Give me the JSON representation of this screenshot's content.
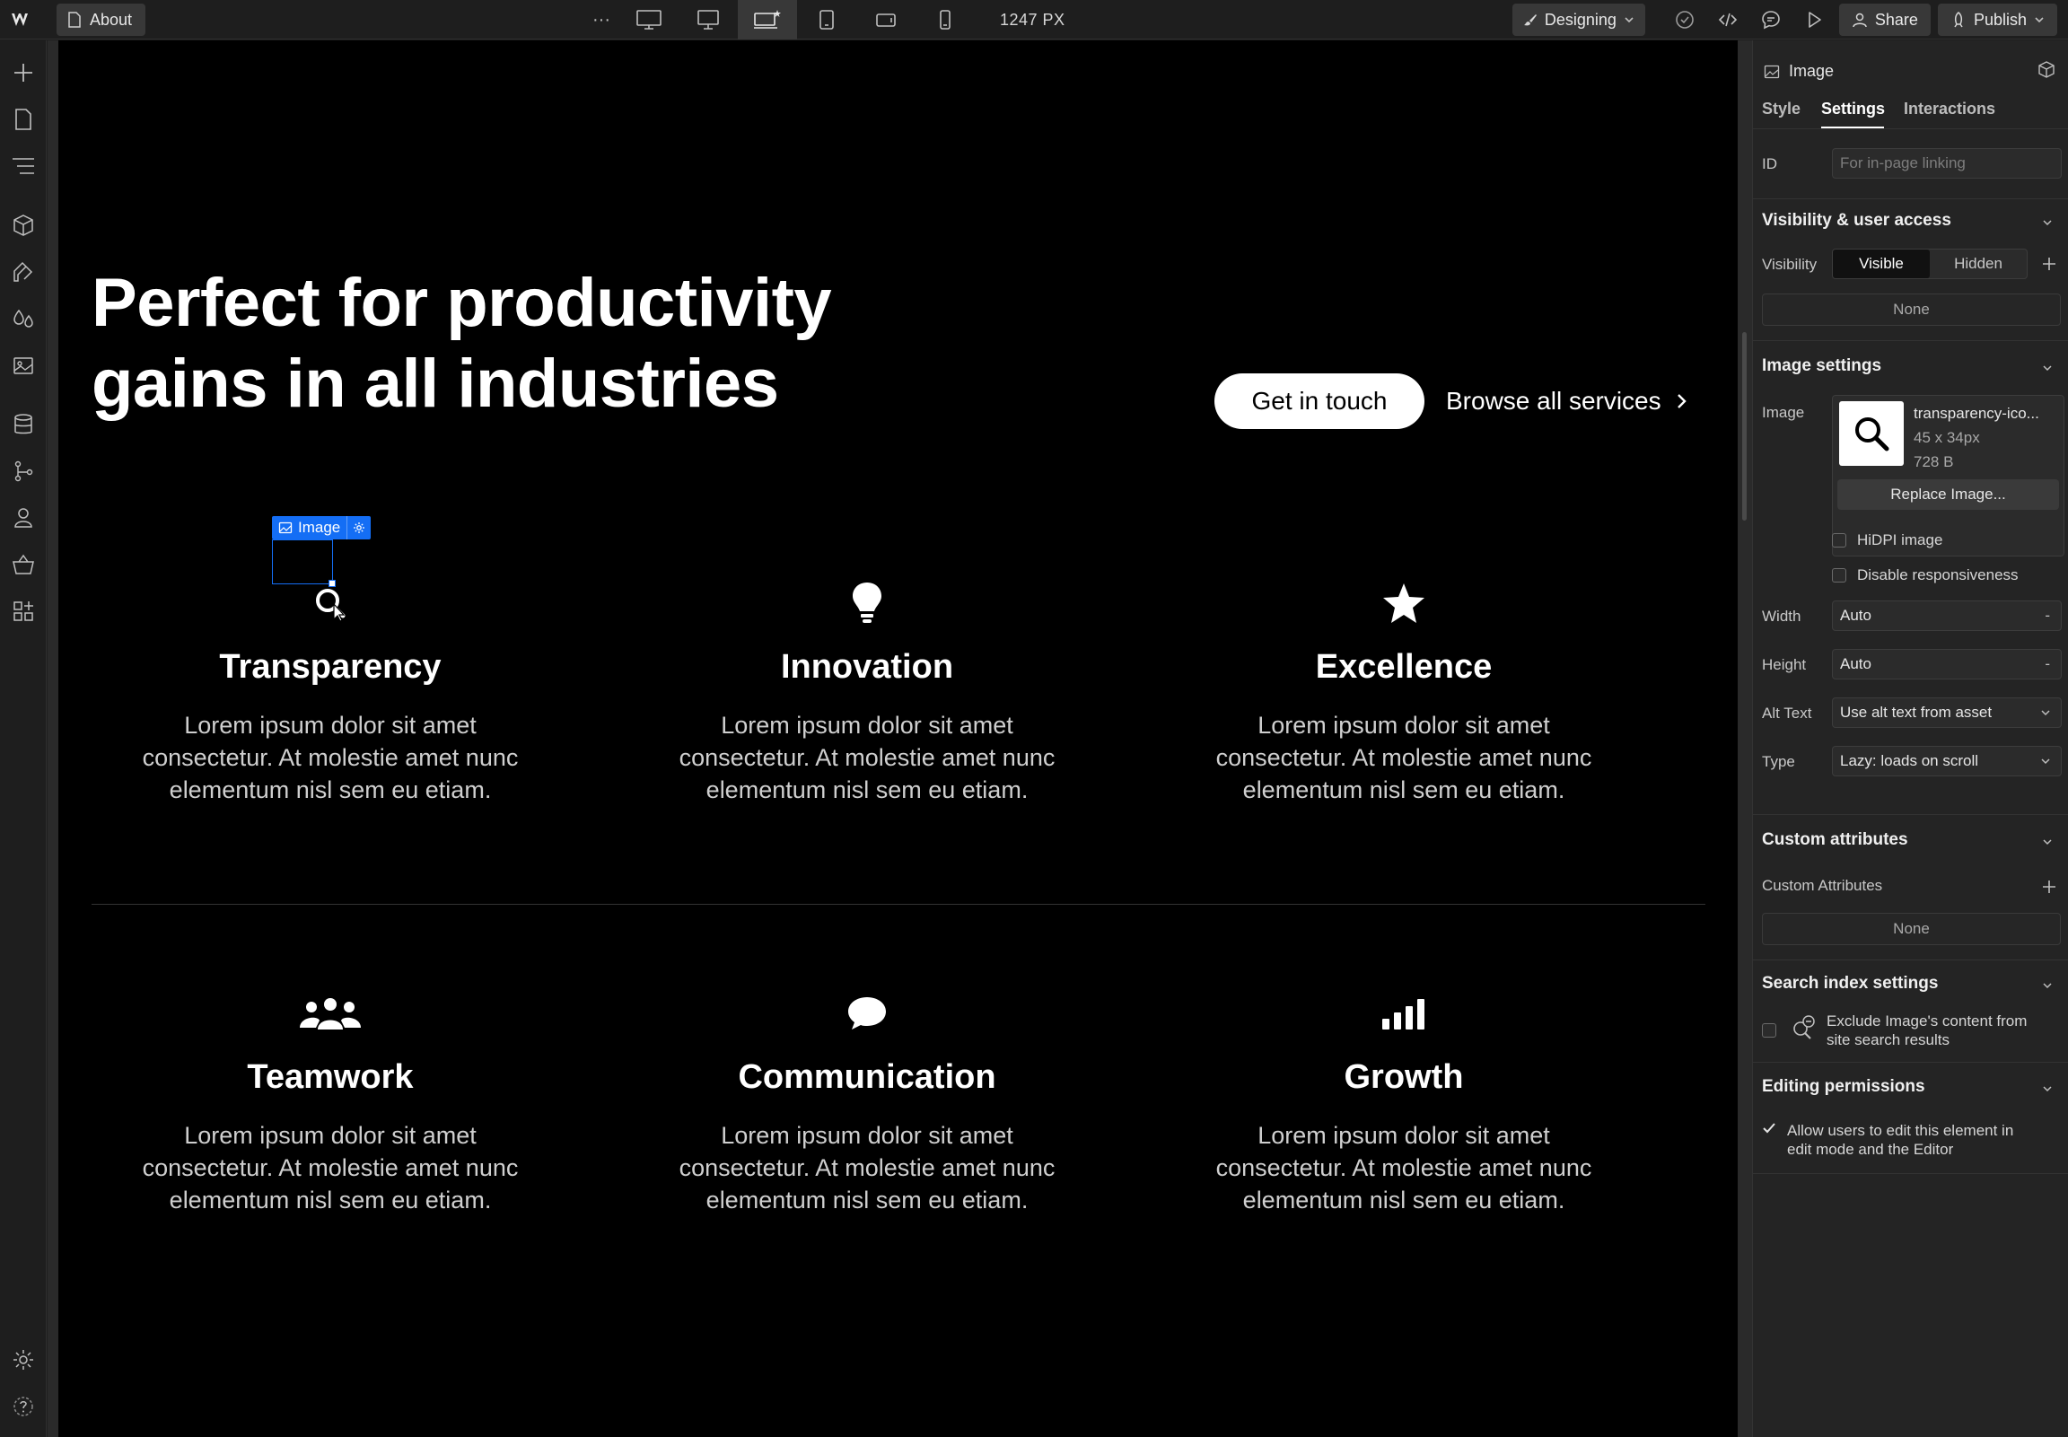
{
  "topbar": {
    "page_name": "About",
    "more_glyph": "···",
    "breakpoint_width": "1247 PX",
    "mode_label": "Designing",
    "share_label": "Share",
    "publish_label": "Publish"
  },
  "hero": {
    "title_line1": "Perfect for productivity",
    "title_line2": "gains in all industries",
    "primary_cta": "Get in touch",
    "secondary_cta": "Browse all services"
  },
  "features": [
    {
      "icon": "search-icon",
      "name": "Transparency",
      "desc": "Lorem ipsum dolor sit amet consectetur. At molestie amet nunc elementum nisl sem eu etiam."
    },
    {
      "icon": "lightbulb-icon",
      "name": "Innovation",
      "desc": "Lorem ipsum dolor sit amet consectetur. At molestie amet nunc elementum nisl sem eu etiam."
    },
    {
      "icon": "star-icon",
      "name": "Excellence",
      "desc": "Lorem ipsum dolor sit amet consectetur. At molestie amet nunc elementum nisl sem eu etiam."
    },
    {
      "icon": "people-icon",
      "name": "Teamwork",
      "desc": "Lorem ipsum dolor sit amet consectetur. At molestie amet nunc elementum nisl sem eu etiam."
    },
    {
      "icon": "chat-bubble-icon",
      "name": "Communication",
      "desc": "Lorem ipsum dolor sit amet consectetur. At molestie amet nunc elementum nisl sem eu etiam."
    },
    {
      "icon": "signal-bars-icon",
      "name": "Growth",
      "desc": "Lorem ipsum dolor sit amet consectetur. At molestie amet nunc elementum nisl sem eu etiam."
    }
  ],
  "selection": {
    "tag_label": "Image"
  },
  "panel": {
    "element_type": "Image",
    "tabs": [
      "Style",
      "Settings",
      "Interactions"
    ],
    "active_tab": "Settings",
    "id_label": "ID",
    "id_placeholder": "For in-page linking",
    "visibility": {
      "title": "Visibility & user access",
      "label": "Visibility",
      "options": [
        "Visible",
        "Hidden"
      ],
      "selected": "Visible",
      "none": "None"
    },
    "image_settings": {
      "title": "Image settings",
      "image_label": "Image",
      "asset_name": "transparency-ico...",
      "asset_dims": "45 x 34px",
      "asset_size": "728 B",
      "replace_label": "Replace Image...",
      "hidpi_label": "HiDPI image",
      "disable_resp_label": "Disable responsiveness",
      "width_label": "Width",
      "width_value": "Auto",
      "height_label": "Height",
      "height_value": "Auto",
      "alt_label": "Alt Text",
      "alt_value": "Use alt text from asset",
      "type_label": "Type",
      "type_value": "Lazy: loads on scroll",
      "dash": "-"
    },
    "custom_attributes": {
      "title": "Custom attributes",
      "label": "Custom Attributes",
      "none": "None"
    },
    "search_index": {
      "title": "Search index settings",
      "exclude_line1": "Exclude Image's content from",
      "exclude_line2": "site search results"
    },
    "editing": {
      "title": "Editing permissions",
      "allow_line1": "Allow users to edit this element in",
      "allow_line2": "edit mode and the Editor"
    }
  },
  "colors": {
    "accent": "#146ef5",
    "canvas_bg": "#000000",
    "chrome_bg": "#1e1e1e",
    "panel_bg": "#242424"
  }
}
